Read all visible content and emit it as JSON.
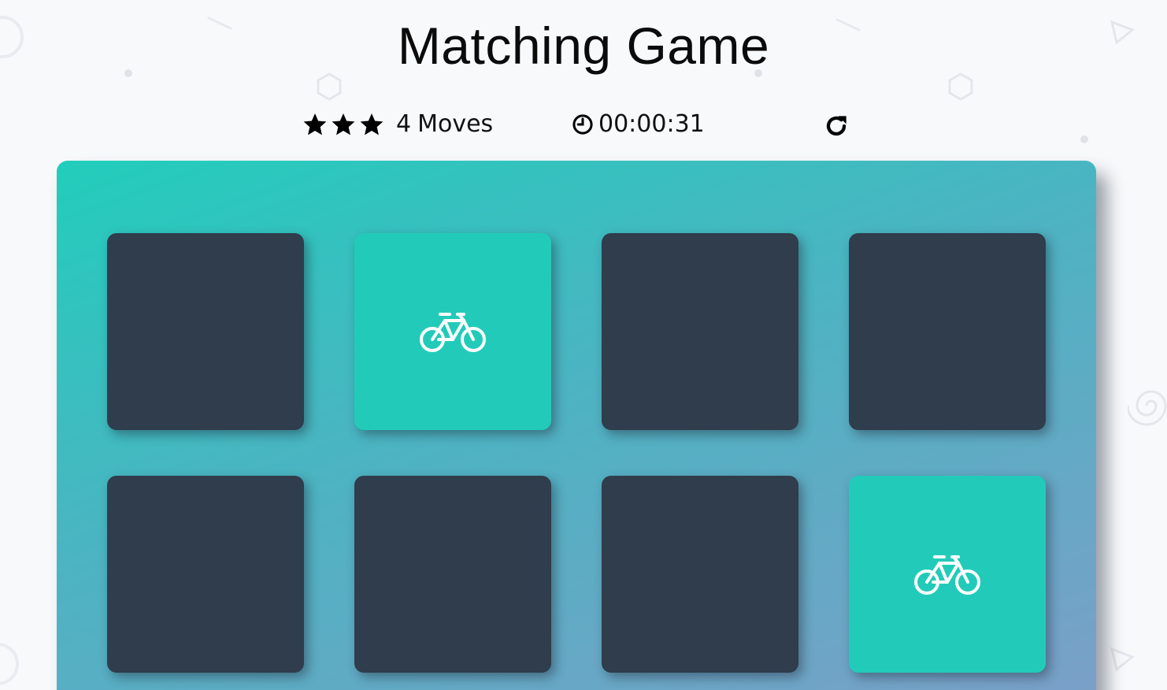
{
  "game": {
    "title": "Matching Game"
  },
  "score_panel": {
    "star_rating": 3,
    "stars_icon": "star-icon",
    "moves_count": "4",
    "moves_label": "Moves",
    "timer_icon": "clock-icon",
    "timer": "00:00:31",
    "restart_icon": "redo-icon"
  },
  "deck": {
    "columns": 4,
    "cards": [
      {
        "state": "closed",
        "icon": ""
      },
      {
        "state": "open",
        "icon": "bicycle-icon"
      },
      {
        "state": "closed",
        "icon": ""
      },
      {
        "state": "closed",
        "icon": ""
      },
      {
        "state": "closed",
        "icon": ""
      },
      {
        "state": "closed",
        "icon": ""
      },
      {
        "state": "closed",
        "icon": ""
      },
      {
        "state": "open",
        "icon": "bicycle-icon"
      }
    ]
  },
  "colors": {
    "card_back": "#2f3d4c",
    "card_open": "#22cbb9",
    "deck_gradient_start": "#22cdbc",
    "deck_gradient_end": "#7c9fc8"
  }
}
